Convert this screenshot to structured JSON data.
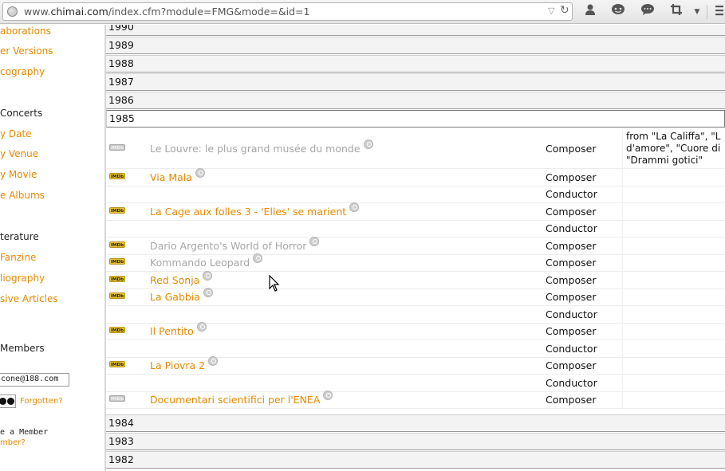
{
  "browser": {
    "url_prefix": "www.",
    "url_domain": "chimai.com",
    "url_path": "/index.cfm?module=FMG&mode=&id=1",
    "icons": [
      "account-icon",
      "chat-icon",
      "comment-icon",
      "crop-icon",
      "menu-icon"
    ]
  },
  "sidebar": {
    "links_top": [
      "aborations",
      "er Versions",
      "cography"
    ],
    "concerts_heading": "Concerts",
    "concerts_links": [
      "y Date",
      "y Venue",
      "y Movie",
      "e Albums"
    ],
    "literature_heading": "terature",
    "literature_links": [
      "Fanzine",
      "liography",
      "sive Articles"
    ],
    "members_heading": "Members",
    "login": {
      "email_value": "cone@188.com",
      "forgot_label": "Forgotten?",
      "become_label": "e a Member",
      "member_link": "mber?"
    }
  },
  "years_before": [
    "1990",
    "1989",
    "1988",
    "1987",
    "1986"
  ],
  "expanded_year": "1985",
  "films": [
    {
      "title": "Le Louvre: le plus grand musée du monde",
      "active": false,
      "imdb": false,
      "roles": [
        "Composer"
      ],
      "notes": [
        "from \"La Califfa\", \"L",
        "d'amore\", \"Cuore di",
        "\"Drammi gotici\""
      ]
    },
    {
      "title": "Via Mala",
      "active": true,
      "imdb": true,
      "roles": [
        "Composer",
        "Conductor"
      ]
    },
    {
      "title": "La Cage aux folles 3 - 'Elles' se marient",
      "active": true,
      "imdb": true,
      "roles": [
        "Composer",
        "Conductor"
      ]
    },
    {
      "title": "Dario Argento's World of Horror",
      "active": false,
      "imdb": true,
      "roles": [
        "Composer"
      ]
    },
    {
      "title": "Kommando Leopard",
      "active": false,
      "imdb": true,
      "roles": [
        "Composer"
      ]
    },
    {
      "title": "Red Sonja",
      "active": true,
      "imdb": true,
      "roles": [
        "Composer"
      ]
    },
    {
      "title": "La Gabbia",
      "active": true,
      "imdb": true,
      "roles": [
        "Composer",
        "Conductor"
      ]
    },
    {
      "title": "Il Pentito",
      "active": true,
      "imdb": true,
      "roles": [
        "Composer",
        "Conductor"
      ]
    },
    {
      "title": "La Piovra 2",
      "active": true,
      "imdb": true,
      "roles": [
        "Composer",
        "Conductor"
      ]
    },
    {
      "title": "Documentari scientifici per l'ENEA",
      "active": true,
      "imdb": false,
      "roles": [
        "Composer"
      ]
    }
  ],
  "imdb_label": "IMDb",
  "years_after": [
    "1984",
    "1983",
    "1982"
  ]
}
